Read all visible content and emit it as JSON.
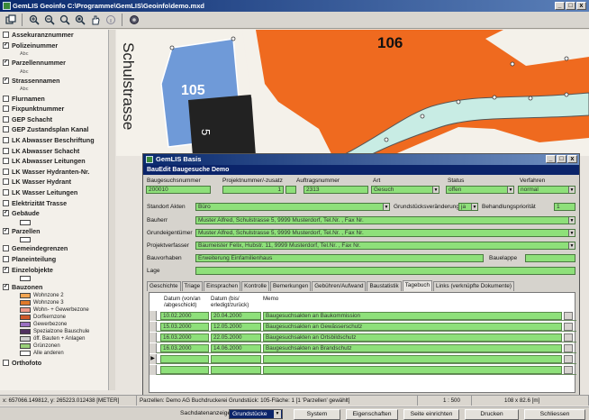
{
  "app": {
    "title": "GemLIS Geoinfo C:\\Programme\\GemLIS\\Geoinfo\\demo.mxd"
  },
  "window_buttons": [
    "_",
    "□",
    "x"
  ],
  "toolbar": {
    "icons": [
      "layer-icon",
      "zoom-in-icon",
      "zoom-out-icon",
      "zoom-window-icon",
      "zoom-full-icon",
      "pan-icon",
      "info-icon",
      "refresh-icon"
    ]
  },
  "legend": {
    "items": [
      {
        "label": "Assekuranznummer",
        "checked": false
      },
      {
        "label": "Polizeinummer",
        "checked": true,
        "sub": "Abc"
      },
      {
        "label": "Parzellennummer",
        "checked": true,
        "sub": "Abc"
      },
      {
        "label": "Strassennamen",
        "checked": true,
        "sub": "Abc"
      },
      {
        "label": "Flurnamen",
        "checked": false
      },
      {
        "label": "Fixpunktnummer",
        "checked": false
      },
      {
        "label": "GEP Schacht",
        "checked": false
      },
      {
        "label": "GEP Zustandsplan Kanal",
        "checked": false
      },
      {
        "label": "LK Abwasser Beschriftung",
        "checked": false
      },
      {
        "label": "LK Abwasser Schacht",
        "checked": false
      },
      {
        "label": "LK Abwasser Leitungen",
        "checked": false
      },
      {
        "label": "LK Wasser Hydranten-Nr.",
        "checked": false
      },
      {
        "label": "LK Wasser Hydrant",
        "checked": false
      },
      {
        "label": "LK Wasser Leitungen",
        "checked": false
      },
      {
        "label": "Elektrizität Trasse",
        "checked": false
      },
      {
        "label": "Gebäude",
        "checked": true,
        "swatch": true
      },
      {
        "label": "Parzellen",
        "checked": true,
        "swatch": true
      },
      {
        "label": "Gemeindegrenzen",
        "checked": false
      },
      {
        "label": "Planeinteilung",
        "checked": false
      },
      {
        "label": "Einzelobjekte",
        "checked": true,
        "swatch": true
      },
      {
        "label": "Bauzonen",
        "checked": true
      }
    ],
    "zones": [
      {
        "label": "Wohnzone 2",
        "color": "#f2a552"
      },
      {
        "label": "Wohnzone 3",
        "color": "#e07a2a"
      },
      {
        "label": "Wohn- + Gewerbezone",
        "color": "#ef9a8a"
      },
      {
        "label": "Dorfkernzone",
        "color": "#d05a2a"
      },
      {
        "label": "Gewerbezone",
        "color": "#9a70c0"
      },
      {
        "label": "Spezialzone Bauschule",
        "color": "#503060"
      },
      {
        "label": "öff. Bauten + Anlagen",
        "color": "#d0d0d0"
      },
      {
        "label": "Grünzonen",
        "color": "#9ad07a"
      },
      {
        "label": "Alle anderen",
        "color": "#ffffff"
      }
    ],
    "last": "Orthofoto"
  },
  "map": {
    "parcel_106": "106",
    "parcel_105": "105",
    "parcel_5": "5",
    "street": "Schulstrasse"
  },
  "dialog": {
    "title": "GemLIS Basis",
    "header": "BauEdit Baugesuche Demo",
    "fields": {
      "baugesuch_label": "Baugesuchsnummer",
      "baugesuch_value": "200010",
      "projekt_label": "Projektnummer/-zusatz",
      "projekt_value": "1",
      "auftrag_label": "Auftragsnummer",
      "auftrag_value": "2313",
      "art_label": "Art",
      "art_value": "Gesuch",
      "status_label": "Status",
      "status_value": "offen",
      "verfahren_label": "Verfahren",
      "verfahren_value": "normal",
      "standort_label": "Standort Akten",
      "standort_value": "Büro",
      "grund_label": "Grundstücksveränderung",
      "grund_value": "ja",
      "prio_label": "Behandlungspriorität",
      "prio_value": "1",
      "bauherr_label": "Bauherr",
      "bauherr_value": "Muster Alfred,  Schulstrasse 5, 9999 Musterdorf,  Tel.Nr.  ,  Fax Nr.",
      "eigent_label": "Grundeigentümer",
      "eigent_value": "Muster Alfred,  Schulstrasse 5, 9999 Musterdorf,  Tel.Nr.  ,  Fax Nr.",
      "verf_label": "Projektverfasser",
      "verf_value": "Baumeister Felix,  Hubstr. 11, 9999 Musterdorf,  Tel.Nr.  ,  Fax Nr.",
      "vorhaben_label": "Bauvorhaben",
      "vorhaben_value": "Erweiterung Einfamilienhaus",
      "baulappe_label": "Bauelappe",
      "lage_label": "Lage"
    },
    "tabs": [
      "Geschichte",
      "Triage",
      "Einsprachen",
      "Kontrolle",
      "Bemerkungen",
      "Gebühren/Aufwand",
      "Baustatistik",
      "Tagebuch",
      "Links (verknüpfte Dokumente)"
    ],
    "active_tab": "Tagebuch",
    "grid": {
      "headers": [
        "Datum (von/an /abgeschickt)",
        "Datum (bis/ erledigt/zurück)",
        "Memo"
      ],
      "rows": [
        [
          "10.02.2000",
          "20.04.2000",
          "Baugesuchsakten an Baukommission"
        ],
        [
          "15.03.2000",
          "12.05.2000",
          "Baugesuchsakten an Gewässerschutz"
        ],
        [
          "16.03.2000",
          "22.05.2000",
          "Baugesuchsakten an Ortsbildschutz"
        ],
        [
          "16.03.2000",
          "14.06.2000",
          "Baugesuchsakten an Brandschutz"
        ]
      ]
    }
  },
  "status": {
    "coords": "x: 657066.149812, y: 265223.012438 [METER]",
    "info": "Parzellen: Demo AG Buchdruckerei Grundstück: 105-Fläche: 1 [1 'Parzellen' gewählt]",
    "scale": "1 : 500",
    "size": "108 x 82.6 [m]"
  },
  "bottom": {
    "sachdaten": "Sachdatenanzeige",
    "select": "Grundstücke",
    "system": "System",
    "eigen": "Eigenschaften",
    "seite": "Seite einrichten",
    "drucken": "Drucken",
    "schliessen": "Schliessen"
  }
}
